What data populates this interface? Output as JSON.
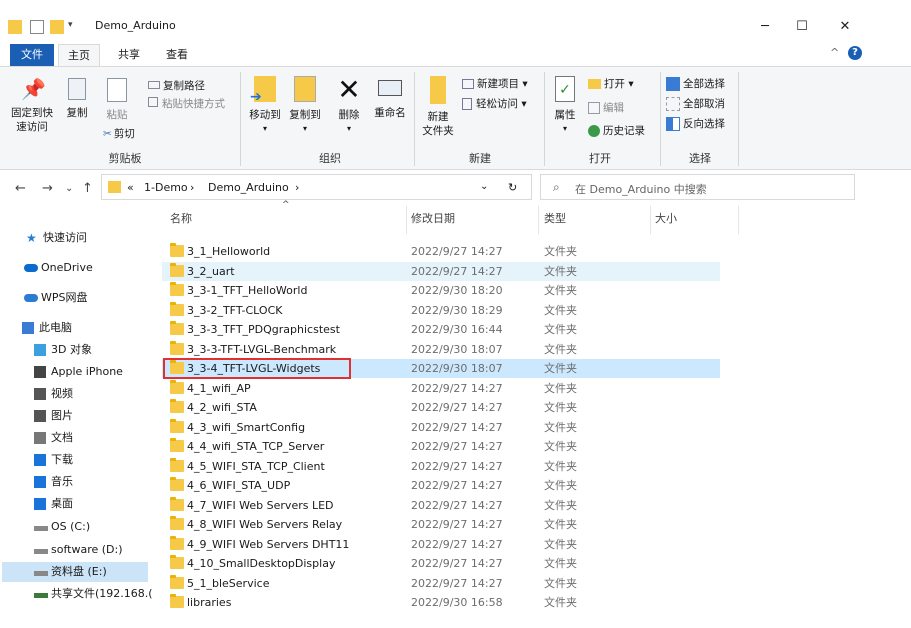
{
  "window": {
    "title": "Demo_Arduino",
    "minimize": "─",
    "maximize": "☐",
    "close": "✕"
  },
  "tabs": [
    "文件",
    "主页",
    "共享",
    "查看"
  ],
  "ribbon": {
    "clipboard": {
      "pin_label": "固定到快\n速访问",
      "copy_label": "复制",
      "paste_label": "粘贴",
      "copy_path": "复制路径",
      "paste_shortcut": "粘贴快捷方式",
      "cut": "剪切",
      "group": "剪贴板"
    },
    "organize": {
      "move_to": "移动到",
      "copy_to": "复制到",
      "delete": "删除",
      "rename": "重命名",
      "group": "组织"
    },
    "new": {
      "new_folder": "新建\n文件夹",
      "new_item": "新建项目 ▾",
      "easy_access": "轻松访问 ▾",
      "group": "新建"
    },
    "open": {
      "properties": "属性",
      "open": "打开 ▾",
      "edit": "编辑",
      "history": "历史记录",
      "group": "打开"
    },
    "select": {
      "select_all": "全部选择",
      "select_none": "全部取消",
      "invert": "反向选择",
      "group": "选择"
    }
  },
  "address": {
    "prefix": "«",
    "crumbs": [
      "1-Demo",
      "Demo_Arduino"
    ],
    "search_placeholder": "在 Demo_Arduino 中搜索"
  },
  "sidebar": {
    "items": [
      {
        "label": "快速访问",
        "icon": "star-icon",
        "color": "#2b7cd3"
      },
      {
        "label": "OneDrive",
        "icon": "cloud-icon",
        "color": "#0a6ccc"
      },
      {
        "label": "WPS网盘",
        "icon": "cloud-outline-icon",
        "color": "#2b7cd3"
      },
      {
        "label": "此电脑",
        "icon": "computer-icon",
        "color": "#3a7bd5"
      },
      {
        "label": "3D 对象",
        "icon": "cube-icon",
        "color": "#3aa0e0"
      },
      {
        "label": "Apple iPhone",
        "icon": "phone-icon",
        "color": "#444"
      },
      {
        "label": "视频",
        "icon": "video-icon",
        "color": "#555"
      },
      {
        "label": "图片",
        "icon": "picture-icon",
        "color": "#555"
      },
      {
        "label": "文档",
        "icon": "document-icon",
        "color": "#777"
      },
      {
        "label": "下载",
        "icon": "download-icon",
        "color": "#1a73d9"
      },
      {
        "label": "音乐",
        "icon": "music-icon",
        "color": "#1a73d9"
      },
      {
        "label": "桌面",
        "icon": "desktop-icon",
        "color": "#1a73d9"
      },
      {
        "label": "OS (C:)",
        "icon": "drive-os-icon",
        "color": "#888"
      },
      {
        "label": "software (D:)",
        "icon": "drive-icon",
        "color": "#888"
      },
      {
        "label": "资料盘 (E:)",
        "icon": "drive-icon",
        "color": "#888"
      },
      {
        "label": "共享文件(192.168.(",
        "icon": "network-drive-icon",
        "color": "#3a7a3a"
      }
    ]
  },
  "columns": {
    "name": "名称",
    "date": "修改日期",
    "type": "类型",
    "size": "大小"
  },
  "files": [
    {
      "name": "3_1_Helloworld",
      "date": "2022/9/27 14:27",
      "type": "文件夹"
    },
    {
      "name": "3_2_uart",
      "date": "2022/9/27 14:27",
      "type": "文件夹"
    },
    {
      "name": "3_3-1_TFT_HelloWorld",
      "date": "2022/9/30 18:20",
      "type": "文件夹"
    },
    {
      "name": "3_3-2_TFT-CLOCK",
      "date": "2022/9/30 18:29",
      "type": "文件夹"
    },
    {
      "name": "3_3-3_TFT_PDQgraphicstest",
      "date": "2022/9/30 16:44",
      "type": "文件夹"
    },
    {
      "name": "3_3-3-TFT-LVGL-Benchmark",
      "date": "2022/9/30 18:07",
      "type": "文件夹"
    },
    {
      "name": "3_3-4_TFT-LVGL-Widgets",
      "date": "2022/9/30 18:07",
      "type": "文件夹"
    },
    {
      "name": "4_1_wifi_AP",
      "date": "2022/9/27 14:27",
      "type": "文件夹"
    },
    {
      "name": "4_2_wifi_STA",
      "date": "2022/9/27 14:27",
      "type": "文件夹"
    },
    {
      "name": "4_3_wifi_SmartConfig",
      "date": "2022/9/27 14:27",
      "type": "文件夹"
    },
    {
      "name": "4_4_wifi_STA_TCP_Server",
      "date": "2022/9/27 14:27",
      "type": "文件夹"
    },
    {
      "name": "4_5_WIFI_STA_TCP_Client",
      "date": "2022/9/27 14:27",
      "type": "文件夹"
    },
    {
      "name": "4_6_WIFI_STA_UDP",
      "date": "2022/9/27 14:27",
      "type": "文件夹"
    },
    {
      "name": "4_7_WIFI Web Servers LED",
      "date": "2022/9/27 14:27",
      "type": "文件夹"
    },
    {
      "name": "4_8_WIFI Web Servers Relay",
      "date": "2022/9/27 14:27",
      "type": "文件夹"
    },
    {
      "name": "4_9_WIFI Web Servers DHT11",
      "date": "2022/9/27 14:27",
      "type": "文件夹"
    },
    {
      "name": "4_10_SmallDesktopDisplay",
      "date": "2022/9/27 14:27",
      "type": "文件夹"
    },
    {
      "name": "5_1_bleService",
      "date": "2022/9/27 14:27",
      "type": "文件夹"
    },
    {
      "name": "libraries",
      "date": "2022/9/30 16:58",
      "type": "文件夹"
    }
  ]
}
